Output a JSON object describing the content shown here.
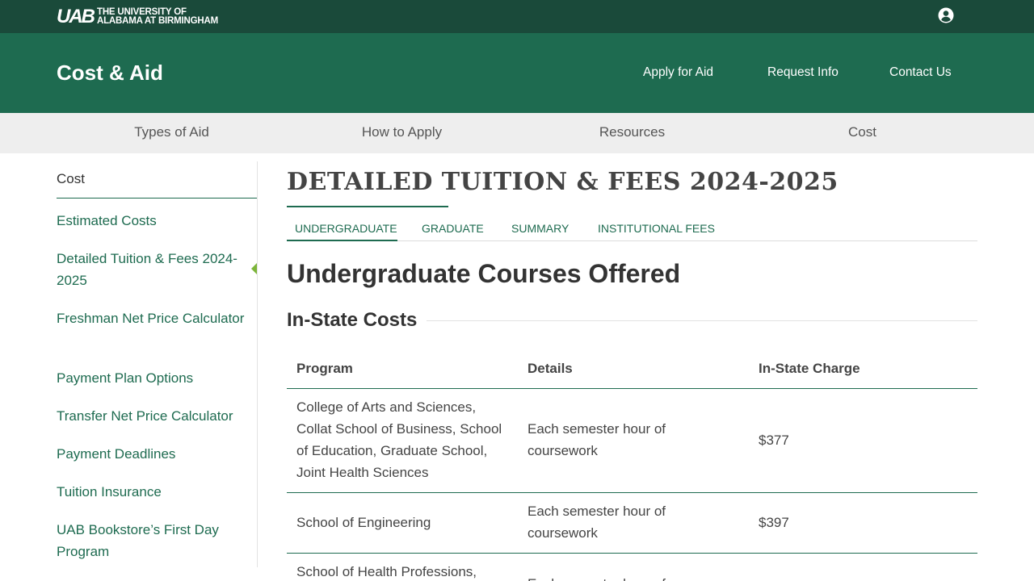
{
  "topbar": {
    "logo_mark": "UAB",
    "logo_line1": "THE UNIVERSITY OF",
    "logo_line2": "ALABAMA AT BIRMINGHAM",
    "user_icon": "user-circle-icon"
  },
  "header": {
    "site_title": "Cost & Aid",
    "nav": [
      "Apply for Aid",
      "Request Info",
      "Contact Us"
    ]
  },
  "subnav": [
    "Types of Aid",
    "How to Apply",
    "Resources",
    "Cost"
  ],
  "sidebar": {
    "heading": "Cost",
    "items": [
      "Estimated Costs",
      "Detailed Tuition & Fees 2024-2025",
      "Freshman Net Price Calculator",
      "Payment Plan Options",
      "Transfer Net Price Calculator",
      "Payment Deadlines",
      "Tuition Insurance",
      "UAB Bookstore’s First Day Program"
    ],
    "active_index": 1
  },
  "main": {
    "title": "DETAILED TUITION & FEES 2024-2025",
    "tabs": [
      "Undergraduate",
      "Graduate",
      "Summary",
      "Institutional Fees"
    ],
    "active_tab": 0,
    "section_title": "Undergraduate Courses Offered",
    "subsection_title": "In-State Costs",
    "table": {
      "headers": [
        "Program",
        "Details",
        "In-State Charge"
      ],
      "rows": [
        [
          "College of Arts and Sciences, Collat School of Business, School of Education, Graduate School, Joint Health Sciences",
          "Each semester hour of coursework",
          "$377"
        ],
        [
          "School of Engineering",
          "Each semester hour of coursework",
          "$397"
        ],
        [
          "School of Health Professions,",
          "Each semester hour of",
          ""
        ]
      ]
    }
  },
  "colors": {
    "topbar": "#1a4a3a",
    "header": "#1e6b50",
    "accent": "#7cb53a",
    "subnav": "#eeeeee"
  }
}
